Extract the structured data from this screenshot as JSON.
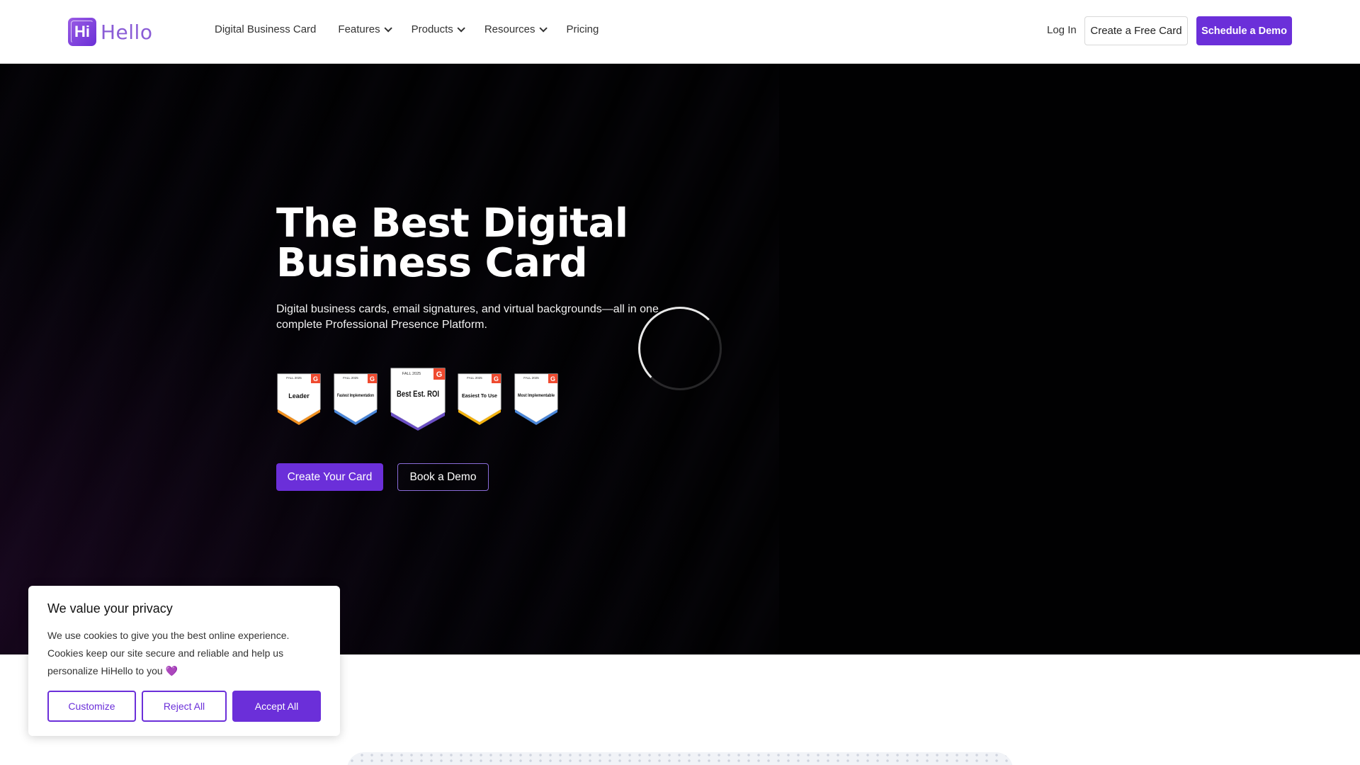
{
  "header": {
    "logo_text": "Hi",
    "logo_word": "Hello",
    "nav": [
      {
        "label": "Digital Business Card",
        "dropdown": false
      },
      {
        "label": "Features",
        "dropdown": true
      },
      {
        "label": "Products",
        "dropdown": true
      },
      {
        "label": "Resources",
        "dropdown": true
      },
      {
        "label": "Pricing",
        "dropdown": false
      }
    ],
    "login_label": "Log In",
    "free_card_label": "Create a Free Card",
    "schedule_demo_label": "Schedule a Demo"
  },
  "hero": {
    "title": "The Best Digital Business Card",
    "subtitle": "Digital business cards, email signatures, and virtual backgrounds—all in one complete Professional Presence Platform.",
    "badges": [
      {
        "season": "FALL 2025",
        "label": "Leader",
        "accent": "#f0901f"
      },
      {
        "season": "FALL 2025",
        "label": "Fastest Implementation",
        "accent": "#4a86d8"
      },
      {
        "season": "FALL 2025",
        "label": "Best Est. ROI",
        "accent": "#6b4fc4"
      },
      {
        "season": "FALL 2025",
        "label": "Easiest To Use",
        "accent": "#f2b20f"
      },
      {
        "season": "FALL 2025",
        "label": "Most Implementable",
        "accent": "#4a86d8"
      }
    ],
    "create_card_label": "Create Your Card",
    "book_demo_label": "Book a Demo"
  },
  "cookie": {
    "title": "We value your privacy",
    "text": "We use cookies to give you the best online experience. Cookies keep our site secure and reliable and help us personalize HiHello to you",
    "heart": "💜",
    "customize_label": "Customize",
    "reject_label": "Reject All",
    "accept_label": "Accept All"
  },
  "colors": {
    "brand_purple": "#6b2fd9",
    "hero_bg": "#010102",
    "g2_red": "#ef4a2f"
  }
}
